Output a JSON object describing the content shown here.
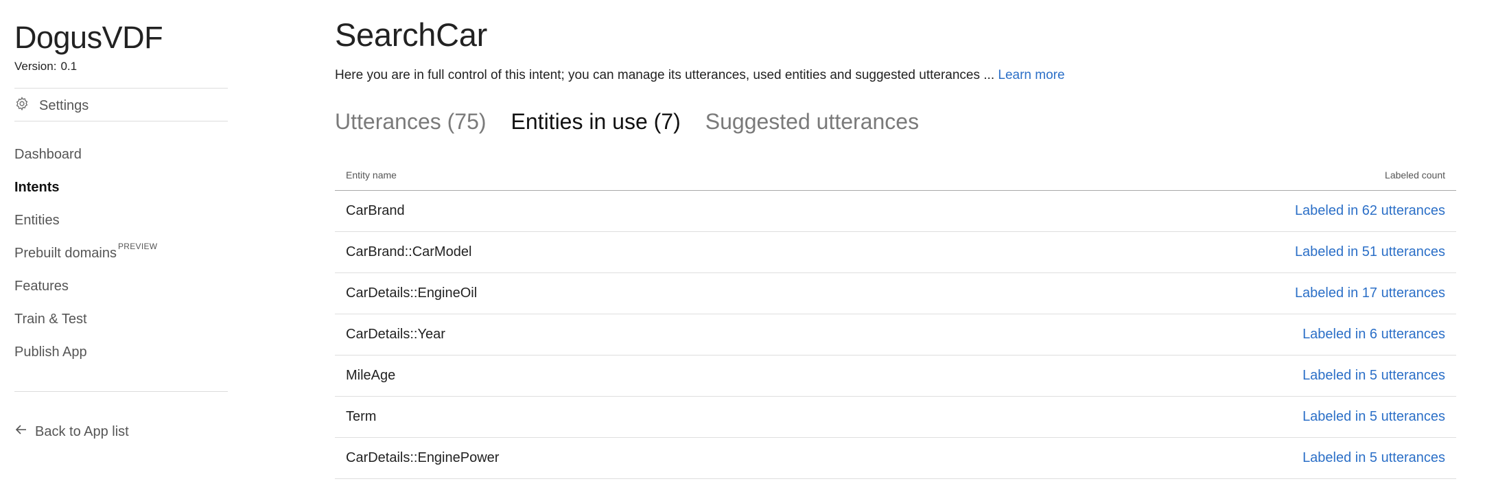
{
  "app": {
    "name": "DogusVDF",
    "version_label": "Version:",
    "version": "0.1"
  },
  "sidebar": {
    "settings_label": "Settings",
    "nav": [
      {
        "label": "Dashboard",
        "active": false
      },
      {
        "label": "Intents",
        "active": true
      },
      {
        "label": "Entities",
        "active": false
      },
      {
        "label": "Prebuilt domains",
        "active": false,
        "tag": "PREVIEW"
      },
      {
        "label": "Features",
        "active": false
      },
      {
        "label": "Train & Test",
        "active": false
      },
      {
        "label": "Publish App",
        "active": false
      }
    ],
    "back_label": "Back to App list"
  },
  "main": {
    "title": "SearchCar",
    "description": "Here you are in full control of this intent; you can manage its utterances, used entities and suggested utterances ...",
    "learn_more": "Learn more",
    "tabs": [
      {
        "label": "Utterances (75)",
        "active": false
      },
      {
        "label": "Entities in use (7)",
        "active": true
      },
      {
        "label": "Suggested utterances",
        "active": false
      }
    ],
    "table": {
      "headers": {
        "entity": "Entity name",
        "count": "Labeled count"
      },
      "rows": [
        {
          "entity": "CarBrand",
          "count": "Labeled in 62 utterances"
        },
        {
          "entity": "CarBrand::CarModel",
          "count": "Labeled in 51 utterances"
        },
        {
          "entity": "CarDetails::EngineOil",
          "count": "Labeled in 17 utterances"
        },
        {
          "entity": "CarDetails::Year",
          "count": "Labeled in 6 utterances"
        },
        {
          "entity": "MileAge",
          "count": "Labeled in 5 utterances"
        },
        {
          "entity": "Term",
          "count": "Labeled in 5 utterances"
        },
        {
          "entity": "CarDetails::EnginePower",
          "count": "Labeled in 5 utterances"
        }
      ]
    }
  },
  "colors": {
    "link": "#2b6fc7",
    "text": "#222222",
    "muted": "#7a7a7a"
  }
}
